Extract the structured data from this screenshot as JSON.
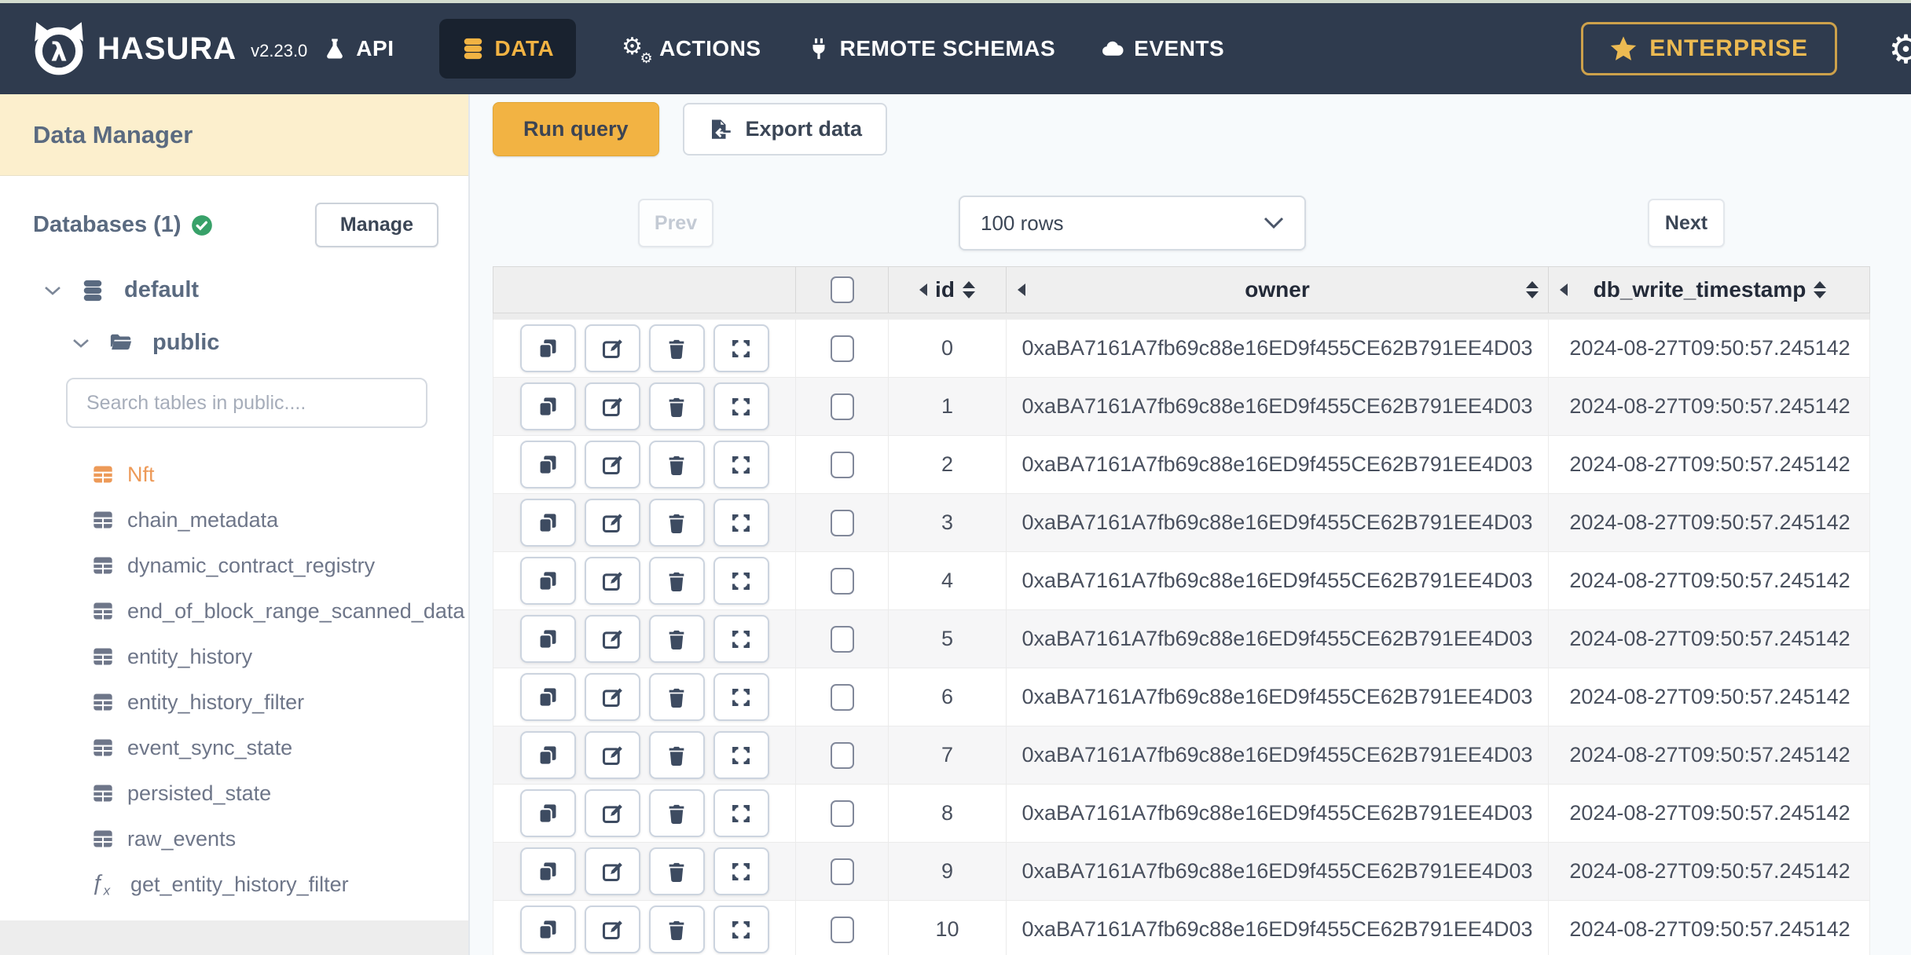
{
  "colors": {
    "nav_bg": "#2f3b4e",
    "nav_active_bg": "#19222f",
    "accent_yellow": "#f2b343",
    "gold": "#ecba52",
    "orange": "#ed9a58",
    "green_ok": "#38a169",
    "cream": "#fcefcd",
    "page_bg": "#f7fafc",
    "slate": "#5a6a80"
  },
  "nav": {
    "brand": "HASURA",
    "version": "v2.23.0",
    "items": [
      {
        "label": "API",
        "icon": "flask-icon",
        "active": false
      },
      {
        "label": "DATA",
        "icon": "database-icon",
        "active": true
      },
      {
        "label": "ACTIONS",
        "icon": "gears-icon",
        "active": false
      },
      {
        "label": "REMOTE SCHEMAS",
        "icon": "plug-icon",
        "active": false
      },
      {
        "label": "EVENTS",
        "icon": "cloud-icon",
        "active": false
      }
    ],
    "enterprise_label": "ENTERPRISE"
  },
  "sidebar": {
    "title": "Data Manager",
    "databases_label": "Databases (1)",
    "manage_label": "Manage",
    "source_name": "default",
    "schema_name": "public",
    "search_placeholder": "Search tables in public....",
    "items": [
      {
        "label": "Nft",
        "icon": "table",
        "selected": true
      },
      {
        "label": "chain_metadata",
        "icon": "table",
        "selected": false
      },
      {
        "label": "dynamic_contract_registry",
        "icon": "table",
        "selected": false
      },
      {
        "label": "end_of_block_range_scanned_data",
        "icon": "table",
        "selected": false
      },
      {
        "label": "entity_history",
        "icon": "table",
        "selected": false
      },
      {
        "label": "entity_history_filter",
        "icon": "table",
        "selected": false
      },
      {
        "label": "event_sync_state",
        "icon": "table",
        "selected": false
      },
      {
        "label": "persisted_state",
        "icon": "table",
        "selected": false
      },
      {
        "label": "raw_events",
        "icon": "table",
        "selected": false
      },
      {
        "label": "get_entity_history_filter",
        "icon": "function",
        "selected": false
      }
    ]
  },
  "toolbar": {
    "run_query_label": "Run query",
    "export_data_label": "Export data"
  },
  "pagination": {
    "prev_label": "Prev",
    "rows_value": "100 rows",
    "next_label": "Next"
  },
  "grid": {
    "columns": [
      "id",
      "owner",
      "db_write_timestamp"
    ],
    "rows": [
      {
        "id": "0",
        "owner": "0xaBA7161A7fb69c88e16ED9f455CE62B791EE4D03",
        "db_write_timestamp": "2024-08-27T09:50:57.245142"
      },
      {
        "id": "1",
        "owner": "0xaBA7161A7fb69c88e16ED9f455CE62B791EE4D03",
        "db_write_timestamp": "2024-08-27T09:50:57.245142"
      },
      {
        "id": "2",
        "owner": "0xaBA7161A7fb69c88e16ED9f455CE62B791EE4D03",
        "db_write_timestamp": "2024-08-27T09:50:57.245142"
      },
      {
        "id": "3",
        "owner": "0xaBA7161A7fb69c88e16ED9f455CE62B791EE4D03",
        "db_write_timestamp": "2024-08-27T09:50:57.245142"
      },
      {
        "id": "4",
        "owner": "0xaBA7161A7fb69c88e16ED9f455CE62B791EE4D03",
        "db_write_timestamp": "2024-08-27T09:50:57.245142"
      },
      {
        "id": "5",
        "owner": "0xaBA7161A7fb69c88e16ED9f455CE62B791EE4D03",
        "db_write_timestamp": "2024-08-27T09:50:57.245142"
      },
      {
        "id": "6",
        "owner": "0xaBA7161A7fb69c88e16ED9f455CE62B791EE4D03",
        "db_write_timestamp": "2024-08-27T09:50:57.245142"
      },
      {
        "id": "7",
        "owner": "0xaBA7161A7fb69c88e16ED9f455CE62B791EE4D03",
        "db_write_timestamp": "2024-08-27T09:50:57.245142"
      },
      {
        "id": "8",
        "owner": "0xaBA7161A7fb69c88e16ED9f455CE62B791EE4D03",
        "db_write_timestamp": "2024-08-27T09:50:57.245142"
      },
      {
        "id": "9",
        "owner": "0xaBA7161A7fb69c88e16ED9f455CE62B791EE4D03",
        "db_write_timestamp": "2024-08-27T09:50:57.245142"
      },
      {
        "id": "10",
        "owner": "0xaBA7161A7fb69c88e16ED9f455CE62B791EE4D03",
        "db_write_timestamp": "2024-08-27T09:50:57.245142"
      }
    ]
  }
}
